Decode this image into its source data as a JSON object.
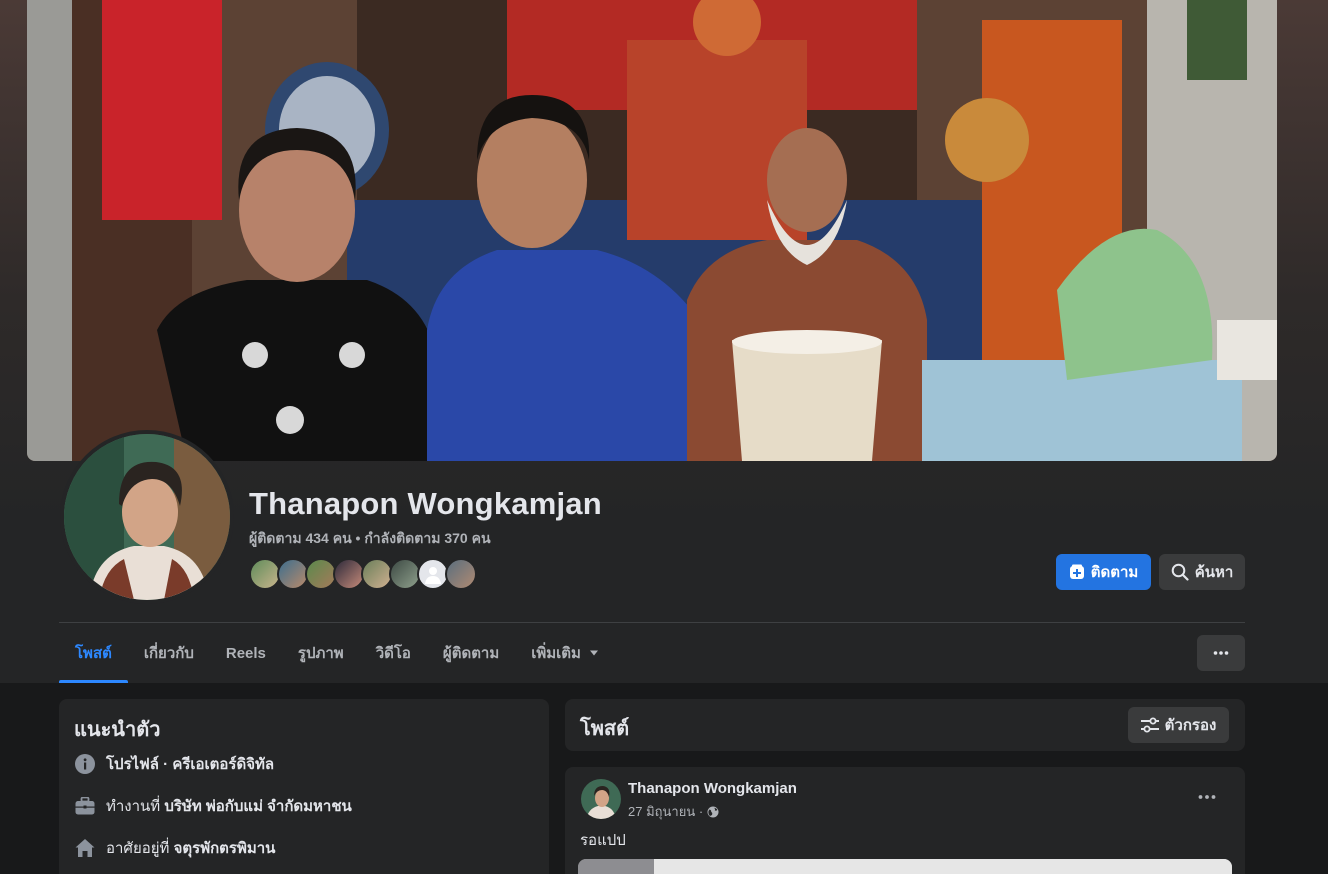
{
  "profile": {
    "name": "Thanapon Wongkamjan",
    "stats": "ผู้ติดตาม 434 คน • กำลังติดตาม 370 คน"
  },
  "actions": {
    "follow_label": "ติดตาม",
    "search_label": "ค้นหา"
  },
  "tabs": [
    {
      "label": "โพสต์",
      "active": true
    },
    {
      "label": "เกี่ยวกับ"
    },
    {
      "label": "Reels"
    },
    {
      "label": "รูปภาพ"
    },
    {
      "label": "วิดีโอ"
    },
    {
      "label": "ผู้ติดตาม"
    },
    {
      "label": "เพิ่มเติม"
    }
  ],
  "intro": {
    "title": "แนะนำตัว",
    "items": [
      {
        "icon": "info-icon",
        "prefix": "",
        "bold": "โปรไฟล์ · ครีเอเตอร์ดิจิทัล"
      },
      {
        "icon": "briefcase-icon",
        "prefix": "ทำงานที่ ",
        "bold": "บริษัท พ่อกับแม่ จำกัดมหาชน"
      },
      {
        "icon": "home-icon",
        "prefix": "อาศัยอยู่ที่ ",
        "bold": "จตุรพักตรพิมาน"
      }
    ]
  },
  "posts_section": {
    "title": "โพสต์",
    "filter_label": "ตัวกรอง"
  },
  "post": {
    "author": "Thanapon Wongkamjan",
    "date": "27 มิถุนายน ·",
    "text": "รอแปป",
    "privacy_icon": "globe-icon"
  },
  "colors": {
    "accent": "#2374e1",
    "tab_active": "#2d88ff",
    "surface": "#242526",
    "background": "#18191a",
    "button_gray": "#3a3b3c"
  }
}
